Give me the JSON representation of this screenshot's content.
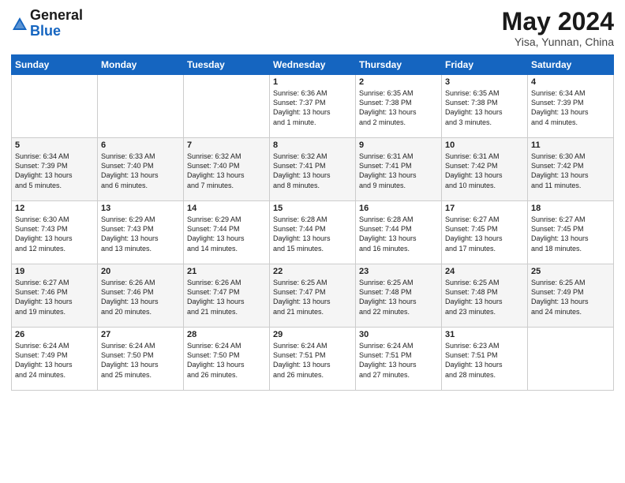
{
  "logo": {
    "general": "General",
    "blue": "Blue"
  },
  "header": {
    "month": "May 2024",
    "location": "Yisa, Yunnan, China"
  },
  "weekdays": [
    "Sunday",
    "Monday",
    "Tuesday",
    "Wednesday",
    "Thursday",
    "Friday",
    "Saturday"
  ],
  "weeks": [
    [
      {
        "day": "",
        "text": ""
      },
      {
        "day": "",
        "text": ""
      },
      {
        "day": "",
        "text": ""
      },
      {
        "day": "1",
        "text": "Sunrise: 6:36 AM\nSunset: 7:37 PM\nDaylight: 13 hours\nand 1 minute."
      },
      {
        "day": "2",
        "text": "Sunrise: 6:35 AM\nSunset: 7:38 PM\nDaylight: 13 hours\nand 2 minutes."
      },
      {
        "day": "3",
        "text": "Sunrise: 6:35 AM\nSunset: 7:38 PM\nDaylight: 13 hours\nand 3 minutes."
      },
      {
        "day": "4",
        "text": "Sunrise: 6:34 AM\nSunset: 7:39 PM\nDaylight: 13 hours\nand 4 minutes."
      }
    ],
    [
      {
        "day": "5",
        "text": "Sunrise: 6:34 AM\nSunset: 7:39 PM\nDaylight: 13 hours\nand 5 minutes."
      },
      {
        "day": "6",
        "text": "Sunrise: 6:33 AM\nSunset: 7:40 PM\nDaylight: 13 hours\nand 6 minutes."
      },
      {
        "day": "7",
        "text": "Sunrise: 6:32 AM\nSunset: 7:40 PM\nDaylight: 13 hours\nand 7 minutes."
      },
      {
        "day": "8",
        "text": "Sunrise: 6:32 AM\nSunset: 7:41 PM\nDaylight: 13 hours\nand 8 minutes."
      },
      {
        "day": "9",
        "text": "Sunrise: 6:31 AM\nSunset: 7:41 PM\nDaylight: 13 hours\nand 9 minutes."
      },
      {
        "day": "10",
        "text": "Sunrise: 6:31 AM\nSunset: 7:42 PM\nDaylight: 13 hours\nand 10 minutes."
      },
      {
        "day": "11",
        "text": "Sunrise: 6:30 AM\nSunset: 7:42 PM\nDaylight: 13 hours\nand 11 minutes."
      }
    ],
    [
      {
        "day": "12",
        "text": "Sunrise: 6:30 AM\nSunset: 7:43 PM\nDaylight: 13 hours\nand 12 minutes."
      },
      {
        "day": "13",
        "text": "Sunrise: 6:29 AM\nSunset: 7:43 PM\nDaylight: 13 hours\nand 13 minutes."
      },
      {
        "day": "14",
        "text": "Sunrise: 6:29 AM\nSunset: 7:44 PM\nDaylight: 13 hours\nand 14 minutes."
      },
      {
        "day": "15",
        "text": "Sunrise: 6:28 AM\nSunset: 7:44 PM\nDaylight: 13 hours\nand 15 minutes."
      },
      {
        "day": "16",
        "text": "Sunrise: 6:28 AM\nSunset: 7:44 PM\nDaylight: 13 hours\nand 16 minutes."
      },
      {
        "day": "17",
        "text": "Sunrise: 6:27 AM\nSunset: 7:45 PM\nDaylight: 13 hours\nand 17 minutes."
      },
      {
        "day": "18",
        "text": "Sunrise: 6:27 AM\nSunset: 7:45 PM\nDaylight: 13 hours\nand 18 minutes."
      }
    ],
    [
      {
        "day": "19",
        "text": "Sunrise: 6:27 AM\nSunset: 7:46 PM\nDaylight: 13 hours\nand 19 minutes."
      },
      {
        "day": "20",
        "text": "Sunrise: 6:26 AM\nSunset: 7:46 PM\nDaylight: 13 hours\nand 20 minutes."
      },
      {
        "day": "21",
        "text": "Sunrise: 6:26 AM\nSunset: 7:47 PM\nDaylight: 13 hours\nand 21 minutes."
      },
      {
        "day": "22",
        "text": "Sunrise: 6:25 AM\nSunset: 7:47 PM\nDaylight: 13 hours\nand 21 minutes."
      },
      {
        "day": "23",
        "text": "Sunrise: 6:25 AM\nSunset: 7:48 PM\nDaylight: 13 hours\nand 22 minutes."
      },
      {
        "day": "24",
        "text": "Sunrise: 6:25 AM\nSunset: 7:48 PM\nDaylight: 13 hours\nand 23 minutes."
      },
      {
        "day": "25",
        "text": "Sunrise: 6:25 AM\nSunset: 7:49 PM\nDaylight: 13 hours\nand 24 minutes."
      }
    ],
    [
      {
        "day": "26",
        "text": "Sunrise: 6:24 AM\nSunset: 7:49 PM\nDaylight: 13 hours\nand 24 minutes."
      },
      {
        "day": "27",
        "text": "Sunrise: 6:24 AM\nSunset: 7:50 PM\nDaylight: 13 hours\nand 25 minutes."
      },
      {
        "day": "28",
        "text": "Sunrise: 6:24 AM\nSunset: 7:50 PM\nDaylight: 13 hours\nand 26 minutes."
      },
      {
        "day": "29",
        "text": "Sunrise: 6:24 AM\nSunset: 7:51 PM\nDaylight: 13 hours\nand 26 minutes."
      },
      {
        "day": "30",
        "text": "Sunrise: 6:24 AM\nSunset: 7:51 PM\nDaylight: 13 hours\nand 27 minutes."
      },
      {
        "day": "31",
        "text": "Sunrise: 6:23 AM\nSunset: 7:51 PM\nDaylight: 13 hours\nand 28 minutes."
      },
      {
        "day": "",
        "text": ""
      }
    ]
  ]
}
